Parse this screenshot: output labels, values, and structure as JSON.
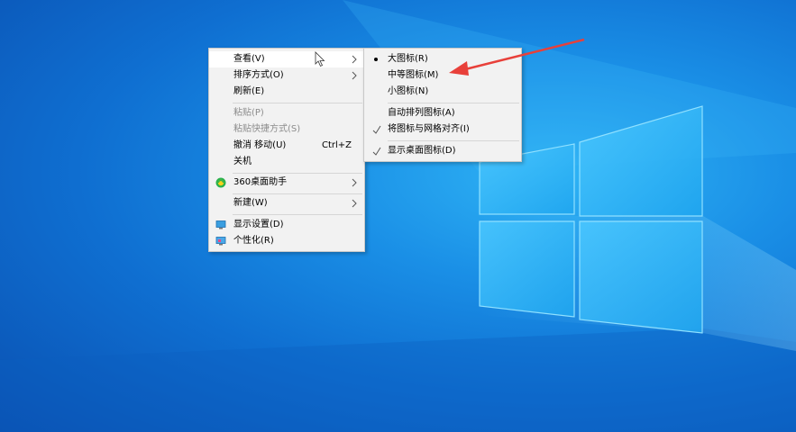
{
  "context_menu": {
    "items": [
      {
        "label": "查看(V)"
      },
      {
        "label": "排序方式(O)"
      },
      {
        "label": "刷新(E)"
      },
      {
        "label": "粘贴(P)"
      },
      {
        "label": "粘贴快捷方式(S)"
      },
      {
        "label": "撤消 移动(U)",
        "shortcut": "Ctrl+Z"
      },
      {
        "label": "关机"
      },
      {
        "label": "360桌面助手"
      },
      {
        "label": "新建(W)"
      },
      {
        "label": "显示设置(D)"
      },
      {
        "label": "个性化(R)"
      }
    ]
  },
  "view_submenu": {
    "items": [
      {
        "label": "大图标(R)",
        "selected": true
      },
      {
        "label": "中等图标(M)"
      },
      {
        "label": "小图标(N)"
      },
      {
        "label": "自动排列图标(A)"
      },
      {
        "label": "将图标与网格对齐(I)",
        "checked": true
      },
      {
        "label": "显示桌面图标(D)",
        "checked": true
      }
    ]
  },
  "annotation": {
    "color": "#e8403a"
  }
}
